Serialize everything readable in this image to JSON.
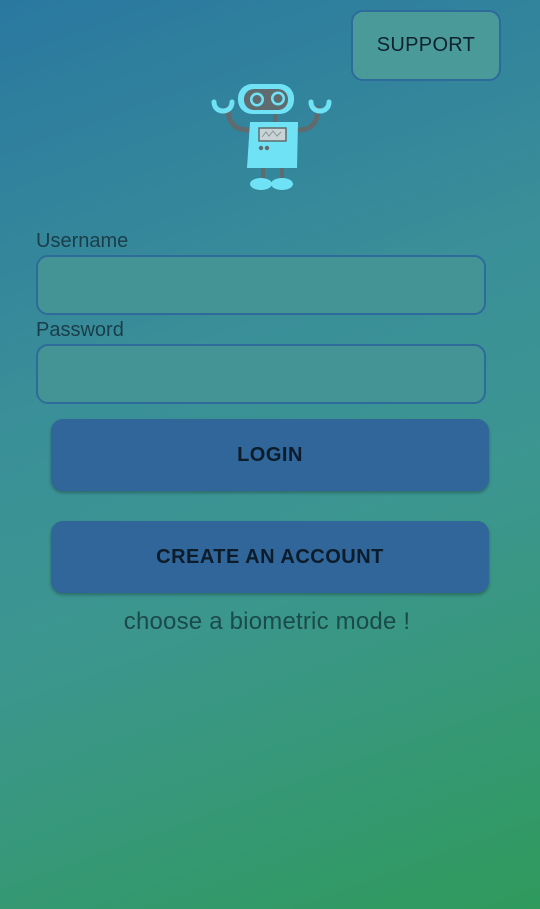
{
  "header": {
    "support_label": "SUPPORT"
  },
  "logo": {
    "icon": "robot-icon",
    "colors": {
      "body": "#6fe3f5",
      "arms": "#5f6b6e",
      "eyes": "#5f6b6e"
    }
  },
  "form": {
    "username_label": "Username",
    "username_value": "",
    "password_label": "Password",
    "password_value": ""
  },
  "actions": {
    "login_label": "LOGIN",
    "create_account_label": "CREATE AN ACCOUNT"
  },
  "biometric": {
    "prompt": "choose a biometric mode !"
  },
  "theme": {
    "gradient_top": "#2a78a0",
    "gradient_bottom": "#2f9a5c",
    "button_fill": "#30669a",
    "field_border": "#2d6b9a"
  }
}
